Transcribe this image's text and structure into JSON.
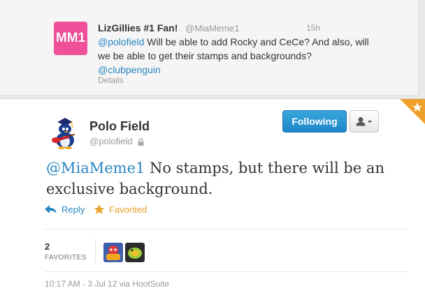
{
  "previous_tweet": {
    "avatar_text": "MM1",
    "display_name": "LizGillies #1 Fan!",
    "handle": "@MiaMeme1",
    "time": "15h",
    "mention1": "@polofield",
    "text": " Will be able to add Rocky and CeCe? And also, will we be able to get their stamps and backgrounds?",
    "mention2": "@clubpenguin",
    "details_link": "Details",
    "avatar_color": "#f0509a"
  },
  "tweet": {
    "display_name": "Polo Field",
    "handle": "@polofield",
    "protected_icon": "lock-icon",
    "follow_button": "Following",
    "user_menu_icon": "user-dropdown-icon",
    "mention": "@MiaMeme1",
    "text": " No stamps, but there will be an exclusive background.",
    "actions": {
      "reply": "Reply",
      "favorited": "Favorited"
    },
    "stats": {
      "favorites_count": "2",
      "favorites_label": "FAVORITES"
    },
    "timestamp": "10:17 AM - 3 Jul 12 via HootSuite",
    "accent_color": "#2a85c2",
    "favorite_color": "#e8a32f"
  }
}
